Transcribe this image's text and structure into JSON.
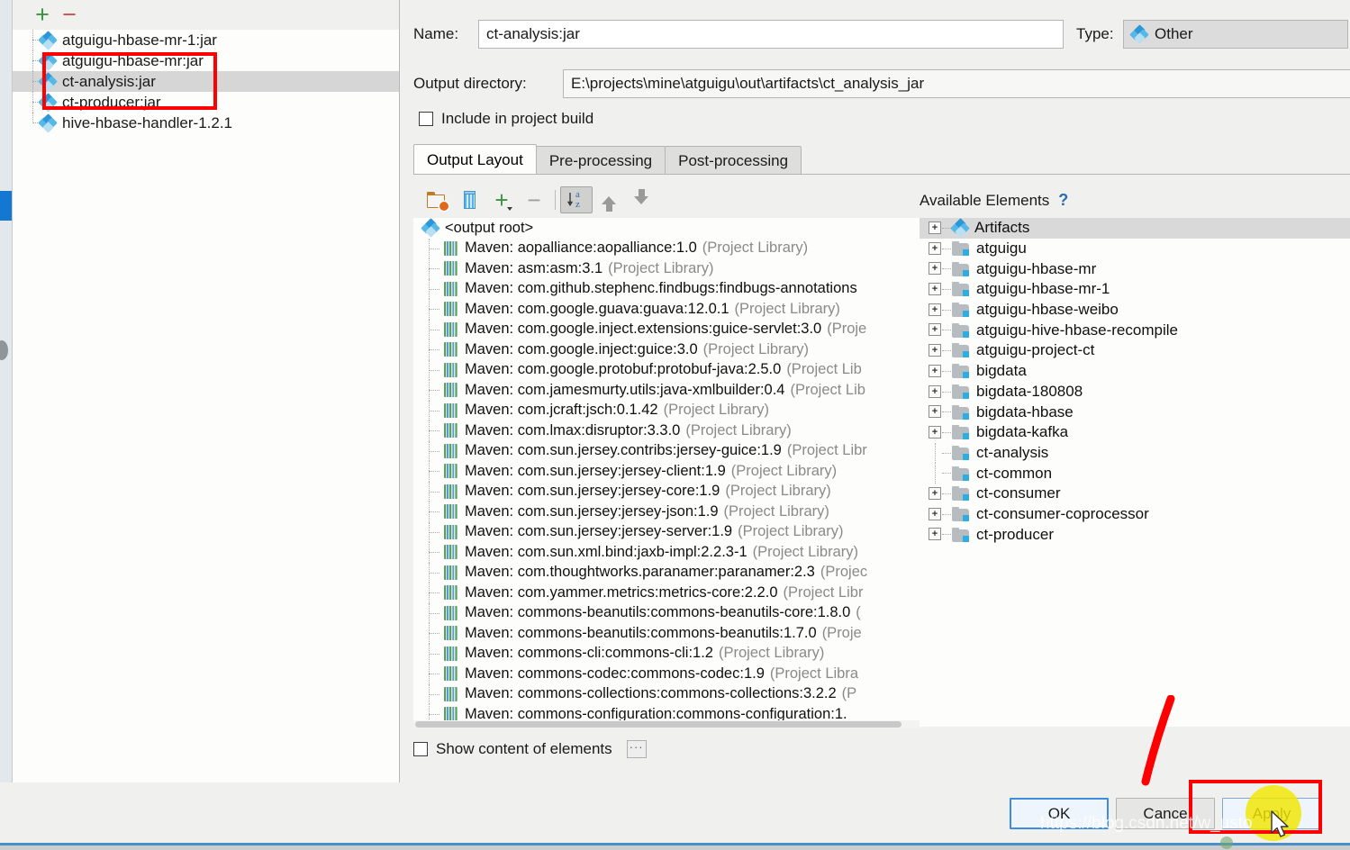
{
  "artifacts_panel": {
    "toolbar": {
      "add_label": "+",
      "remove_label": "−"
    },
    "items": [
      {
        "label": "atguigu-hbase-mr-1:jar",
        "selected": false
      },
      {
        "label": "atguigu-hbase-mr:jar",
        "selected": false
      },
      {
        "label": "ct-analysis:jar",
        "selected": true
      },
      {
        "label": "ct-producer:jar",
        "selected": false
      },
      {
        "label": "hive-hbase-handler-1.2.1",
        "selected": false
      }
    ]
  },
  "detail": {
    "name_label": "Name:",
    "name_value": "ct-analysis:jar",
    "type_label": "Type:",
    "type_value": "Other",
    "output_dir_label": "Output directory:",
    "output_dir_value": "E:\\projects\\mine\\atguigu\\out\\artifacts\\ct_analysis_jar",
    "include_in_build_label": "Include in project build",
    "include_in_build_checked": false,
    "tabs": [
      {
        "label": "Output Layout",
        "active": true
      },
      {
        "label": "Pre-processing",
        "active": false
      },
      {
        "label": "Post-processing",
        "active": false
      }
    ],
    "layout_toolbar": [
      {
        "name": "create-directory-icon",
        "tooltip": "Create Directory"
      },
      {
        "name": "create-archive-icon",
        "tooltip": "Create Archive"
      },
      {
        "name": "add-copy-icon",
        "tooltip": "Add Copy of"
      },
      {
        "name": "remove-icon",
        "tooltip": "Remove"
      },
      {
        "name": "sort-alphabetically-icon",
        "tooltip": "Sort Alphabetically",
        "pressed": true
      },
      {
        "name": "move-up-icon",
        "tooltip": "Move Up"
      },
      {
        "name": "move-down-icon",
        "tooltip": "Move Down"
      }
    ],
    "output_root_label": "<output root>",
    "output_elements": [
      {
        "name": "Maven: aopalliance:aopalliance:1.0",
        "scope": "(Project Library)"
      },
      {
        "name": "Maven: asm:asm:3.1",
        "scope": "(Project Library)"
      },
      {
        "name": "Maven: com.github.stephenc.findbugs:findbugs-annotations",
        "scope": ""
      },
      {
        "name": "Maven: com.google.guava:guava:12.0.1",
        "scope": "(Project Library)"
      },
      {
        "name": "Maven: com.google.inject.extensions:guice-servlet:3.0",
        "scope": "(Proje"
      },
      {
        "name": "Maven: com.google.inject:guice:3.0",
        "scope": "(Project Library)"
      },
      {
        "name": "Maven: com.google.protobuf:protobuf-java:2.5.0",
        "scope": "(Project Lib"
      },
      {
        "name": "Maven: com.jamesmurty.utils:java-xmlbuilder:0.4",
        "scope": "(Project Lib"
      },
      {
        "name": "Maven: com.jcraft:jsch:0.1.42",
        "scope": "(Project Library)"
      },
      {
        "name": "Maven: com.lmax:disruptor:3.3.0",
        "scope": "(Project Library)"
      },
      {
        "name": "Maven: com.sun.jersey.contribs:jersey-guice:1.9",
        "scope": "(Project Libr"
      },
      {
        "name": "Maven: com.sun.jersey:jersey-client:1.9",
        "scope": "(Project Library)"
      },
      {
        "name": "Maven: com.sun.jersey:jersey-core:1.9",
        "scope": "(Project Library)"
      },
      {
        "name": "Maven: com.sun.jersey:jersey-json:1.9",
        "scope": "(Project Library)"
      },
      {
        "name": "Maven: com.sun.jersey:jersey-server:1.9",
        "scope": "(Project Library)"
      },
      {
        "name": "Maven: com.sun.xml.bind:jaxb-impl:2.2.3-1",
        "scope": "(Project Library)"
      },
      {
        "name": "Maven: com.thoughtworks.paranamer:paranamer:2.3",
        "scope": "(Projec"
      },
      {
        "name": "Maven: com.yammer.metrics:metrics-core:2.2.0",
        "scope": "(Project Libr"
      },
      {
        "name": "Maven: commons-beanutils:commons-beanutils-core:1.8.0",
        "scope": "("
      },
      {
        "name": "Maven: commons-beanutils:commons-beanutils:1.7.0",
        "scope": "(Proje"
      },
      {
        "name": "Maven: commons-cli:commons-cli:1.2",
        "scope": "(Project Library)"
      },
      {
        "name": "Maven: commons-codec:commons-codec:1.9",
        "scope": "(Project Libra"
      },
      {
        "name": "Maven: commons-collections:commons-collections:3.2.2",
        "scope": "(P"
      },
      {
        "name": "Maven: commons-configuration:commons-configuration:1.",
        "scope": ""
      }
    ],
    "available_elements_title": "Available Elements",
    "available_elements_help": "?",
    "available_elements": [
      {
        "label": "Artifacts",
        "icon": "artifact-icon",
        "expandable": true,
        "selected": true
      },
      {
        "label": "atguigu",
        "icon": "module-icon",
        "expandable": true,
        "selected": false
      },
      {
        "label": "atguigu-hbase-mr",
        "icon": "module-icon",
        "expandable": true,
        "selected": false
      },
      {
        "label": "atguigu-hbase-mr-1",
        "icon": "module-icon",
        "expandable": true,
        "selected": false
      },
      {
        "label": "atguigu-hbase-weibo",
        "icon": "module-icon",
        "expandable": true,
        "selected": false
      },
      {
        "label": "atguigu-hive-hbase-recompile",
        "icon": "module-icon",
        "expandable": true,
        "selected": false
      },
      {
        "label": "atguigu-project-ct",
        "icon": "module-icon",
        "expandable": true,
        "selected": false
      },
      {
        "label": "bigdata",
        "icon": "module-icon",
        "expandable": true,
        "selected": false
      },
      {
        "label": "bigdata-180808",
        "icon": "module-icon",
        "expandable": true,
        "selected": false
      },
      {
        "label": "bigdata-hbase",
        "icon": "module-icon",
        "expandable": true,
        "selected": false
      },
      {
        "label": "bigdata-kafka",
        "icon": "module-icon",
        "expandable": true,
        "selected": false
      },
      {
        "label": "ct-analysis",
        "icon": "module-icon",
        "expandable": false,
        "selected": false
      },
      {
        "label": "ct-common",
        "icon": "module-icon",
        "expandable": false,
        "selected": false
      },
      {
        "label": "ct-consumer",
        "icon": "module-icon",
        "expandable": true,
        "selected": false
      },
      {
        "label": "ct-consumer-coprocessor",
        "icon": "module-icon",
        "expandable": true,
        "selected": false
      },
      {
        "label": "ct-producer",
        "icon": "module-icon",
        "expandable": true,
        "selected": false
      }
    ],
    "show_content_label": "Show content of elements",
    "show_content_checked": false,
    "ellipsis_label": "···"
  },
  "footer": {
    "ok_label": "OK",
    "cancel_label": "Cance",
    "apply_label": "Apply"
  },
  "annotations": {
    "watermark": "https://blog.csdn.net/w_usto",
    "accent_red": "#fe0000",
    "highlight_yellow": "#f2e600",
    "selection_gray": "#d6d6d6",
    "primary_blue": "#3f8de0"
  }
}
